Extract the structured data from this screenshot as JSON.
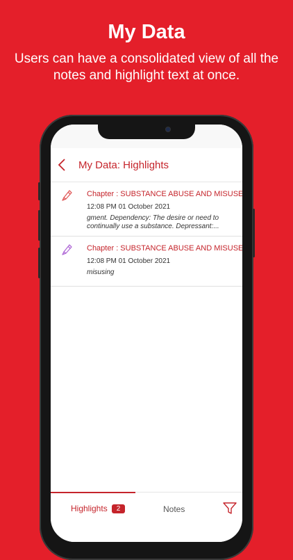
{
  "promo": {
    "title": "My Data",
    "subtitle": "Users can have a consolidated view of all the notes and highlight text at once."
  },
  "nav": {
    "title": "My Data: Highlights",
    "back_icon": "chevron-left-icon"
  },
  "items": [
    {
      "icon": "highlighter-icon",
      "icon_color": "#e05a5a",
      "chapter": "Chapter : SUBSTANCE ABUSE AND MISUSE",
      "date": "12:08 PM 01 October 2021",
      "snippet": "gment.  Dependency: The desire or need to continually use a substance.    Depressant:..."
    },
    {
      "icon": "highlighter-icon",
      "icon_color": "#b06ad6",
      "chapter": "Chapter : SUBSTANCE ABUSE AND MISUSE",
      "date": "12:08 PM 01 October 2021",
      "snippet": "misusing"
    }
  ],
  "tabs": {
    "highlights_label": "Highlights",
    "highlights_count": "2",
    "notes_label": "Notes",
    "filter_icon": "filter-icon"
  },
  "colors": {
    "background": "#e41f2a",
    "accent": "#c5242b"
  }
}
